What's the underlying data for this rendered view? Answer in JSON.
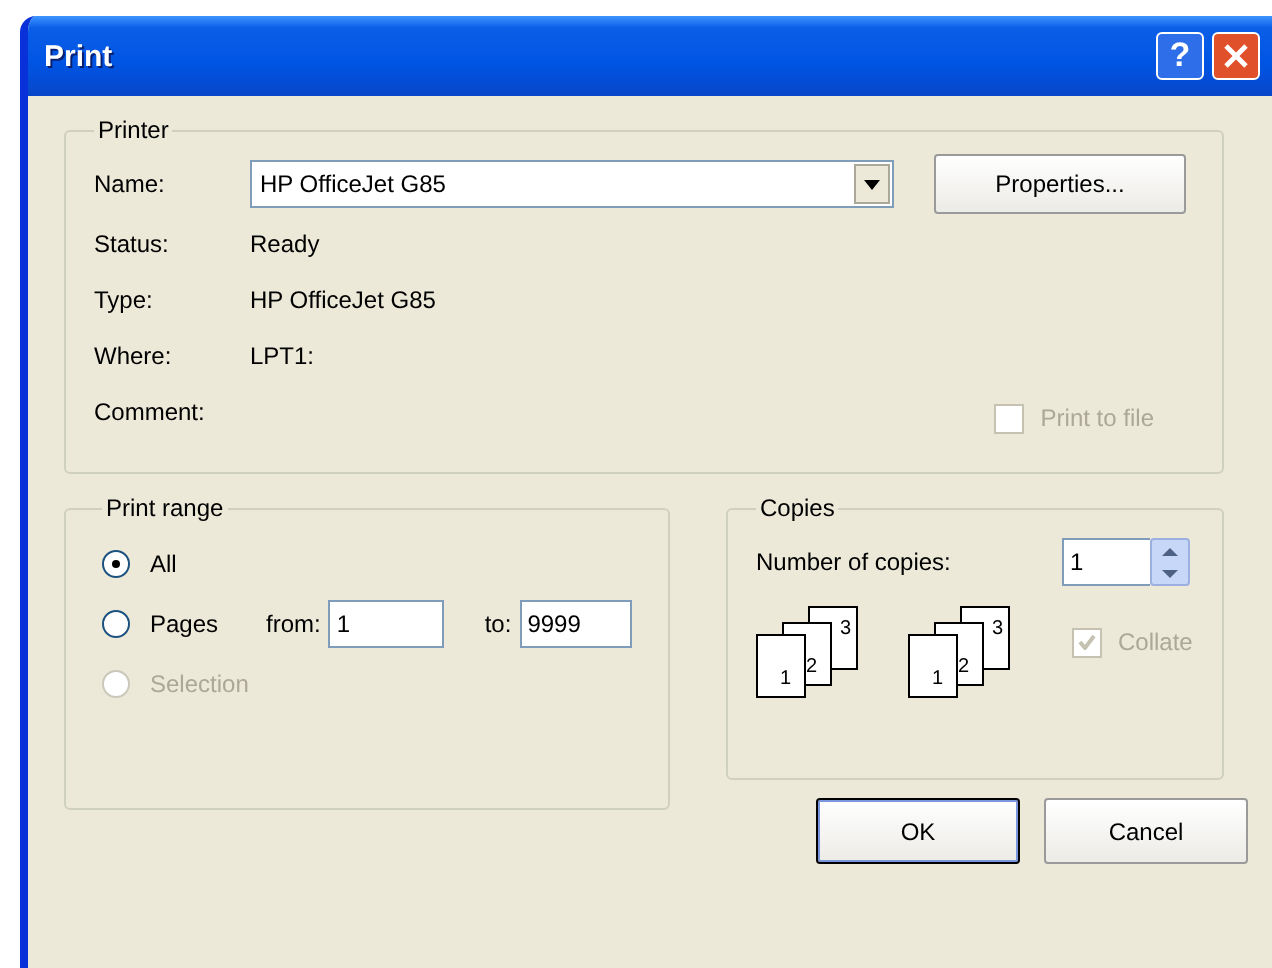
{
  "window": {
    "title": "Print",
    "help": "?"
  },
  "printer": {
    "legend": "Printer",
    "name_label": "Name:",
    "name_value": "HP OfficeJet G85",
    "properties_button": "Properties...",
    "info": [
      {
        "label": "Status:",
        "value": "Ready"
      },
      {
        "label": "Type:",
        "value": "HP OfficeJet G85"
      },
      {
        "label": "Where:",
        "value": "LPT1:"
      },
      {
        "label": "Comment:"
      }
    ],
    "print_to_file": {
      "label": "Print to file",
      "checked": false,
      "disabled": true
    }
  },
  "print_range": {
    "legend": "Print range",
    "options": [
      {
        "label": "All",
        "selected": true,
        "disabled": false
      },
      {
        "label": "Pages",
        "selected": false,
        "disabled": false
      },
      {
        "label": "Selection",
        "selected": false,
        "disabled": true
      }
    ],
    "from_label": "from:",
    "from_value": "1",
    "to_label": "to:",
    "to_value": "9999"
  },
  "copies": {
    "legend": "Copies",
    "count_label": "Number of copies:",
    "count_value": "1",
    "stacks": [
      [
        "1",
        "2",
        "3"
      ],
      [
        "1",
        "2",
        "3"
      ]
    ],
    "collate": {
      "label": "Collate",
      "checked": true,
      "disabled": true
    }
  },
  "buttons": [
    {
      "label": "OK",
      "default": true
    },
    {
      "label": "Cancel",
      "default": false
    }
  ]
}
